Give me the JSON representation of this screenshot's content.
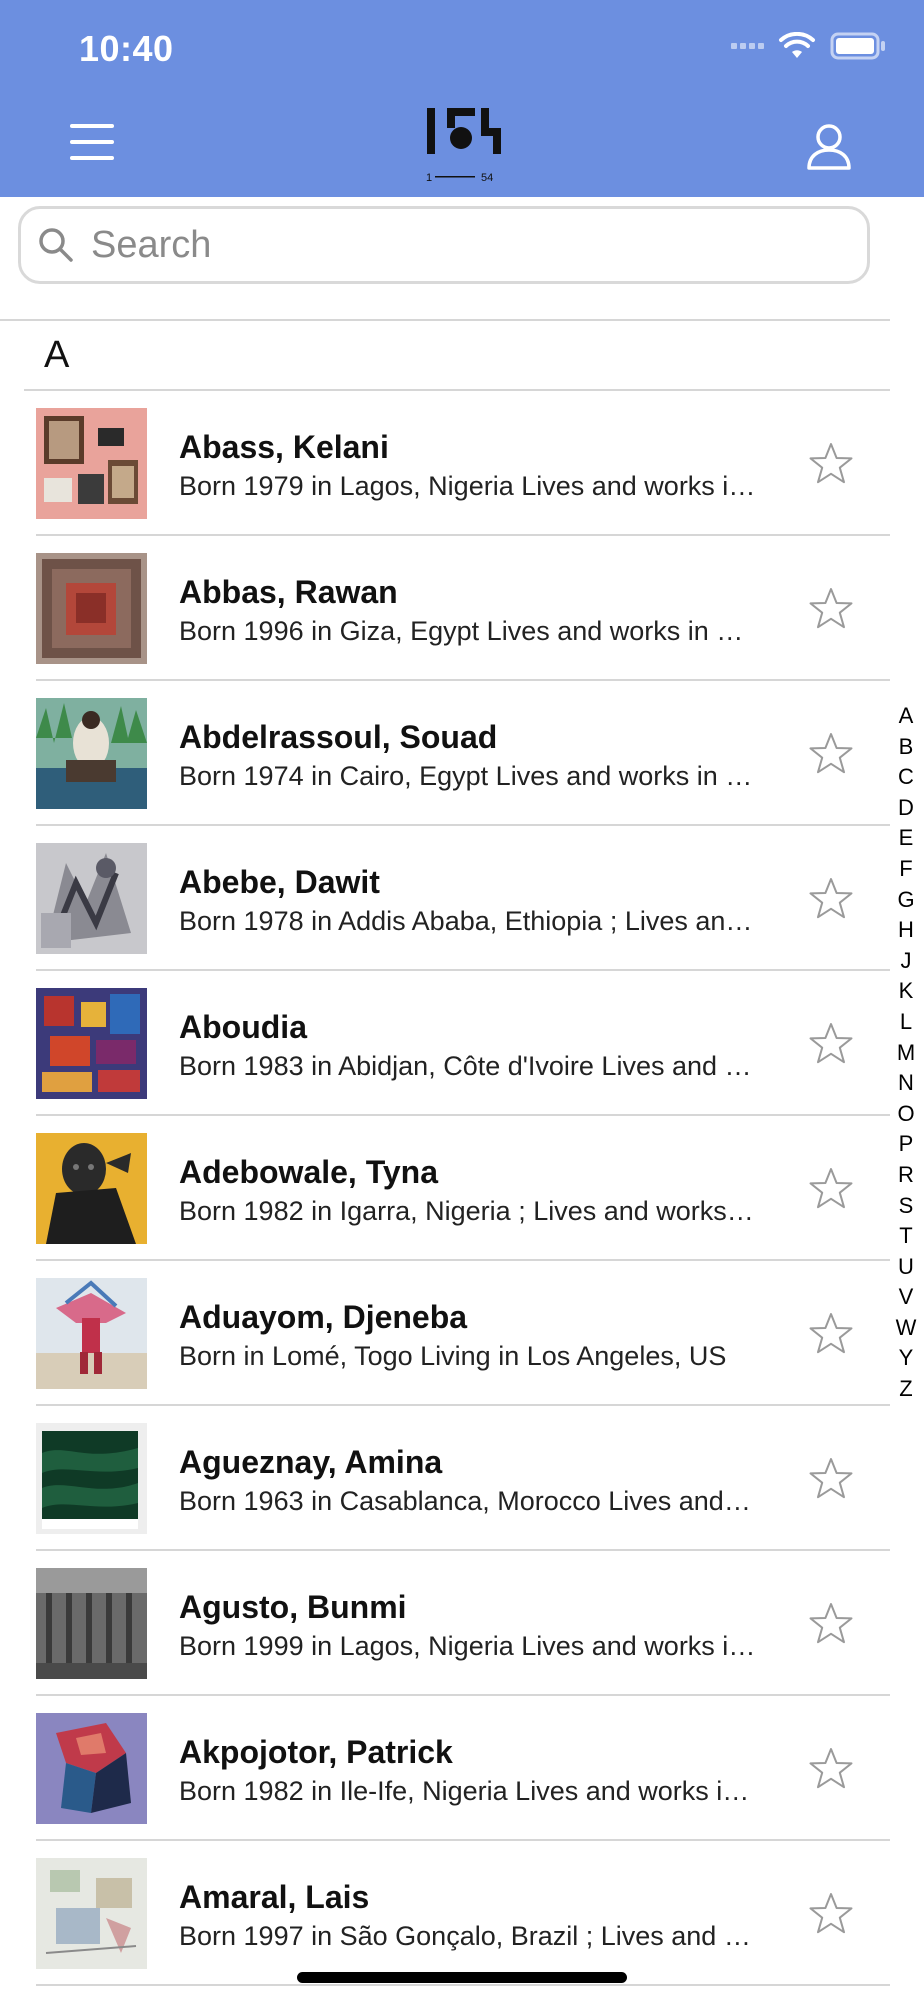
{
  "status_bar": {
    "time": "10:40"
  },
  "search": {
    "placeholder": "Search"
  },
  "section_header": "A",
  "artists": [
    {
      "name": "Abass, Kelani",
      "bio": "Born 1979 in Lagos, Nigeria Lives and works in Lagos"
    },
    {
      "name": "Abbas, Rawan",
      "bio": "Born 1996 in Giza, Egypt Lives and works in Cairo"
    },
    {
      "name": "Abdelrassoul, Souad",
      "bio": "Born 1974 in Cairo, Egypt Lives and works in Cairo"
    },
    {
      "name": "Abebe, Dawit",
      "bio": "Born 1978 in Addis Ababa, Ethiopia ; Lives and works in Addis Ababa"
    },
    {
      "name": "Aboudia",
      "bio": "Born 1983 in Abidjan, Côte d'Ivoire Lives and works in Abidjan"
    },
    {
      "name": "Adebowale, Tyna",
      "bio": "Born 1982 in Igarra, Nigeria ; Lives and works in Lagos"
    },
    {
      "name": "Aduayom, Djeneba",
      "bio": "Born in Lomé, Togo Living in Los Angeles, US"
    },
    {
      "name": "Agueznay, Amina",
      "bio": "Born 1963 in Casablanca, Morocco Lives and works in Marrakech"
    },
    {
      "name": "Agusto, Bunmi",
      "bio": "Born 1999 in Lagos, Nigeria Lives and works in Lagos"
    },
    {
      "name": "Akpojotor, Patrick",
      "bio": "Born 1982 in Ile-Ife, Nigeria Lives and works in Lagos"
    },
    {
      "name": "Amaral, Lais",
      "bio": "Born 1997 in São Gonçalo, Brazil ; Lives and works in Rio de Janeiro"
    }
  ],
  "index_letters": [
    "A",
    "B",
    "C",
    "D",
    "E",
    "F",
    "G",
    "H",
    "J",
    "K",
    "L",
    "M",
    "N",
    "O",
    "P",
    "R",
    "S",
    "T",
    "U",
    "V",
    "W",
    "Y",
    "Z"
  ],
  "icons": {
    "menu": "hamburger-menu-icon",
    "logo": "1-54-logo",
    "profile": "user-profile-icon",
    "search": "magnifier-icon",
    "favorite": "star-outline-icon"
  },
  "colors": {
    "header": "#6c8fe0",
    "divider": "#d6d6d6"
  }
}
